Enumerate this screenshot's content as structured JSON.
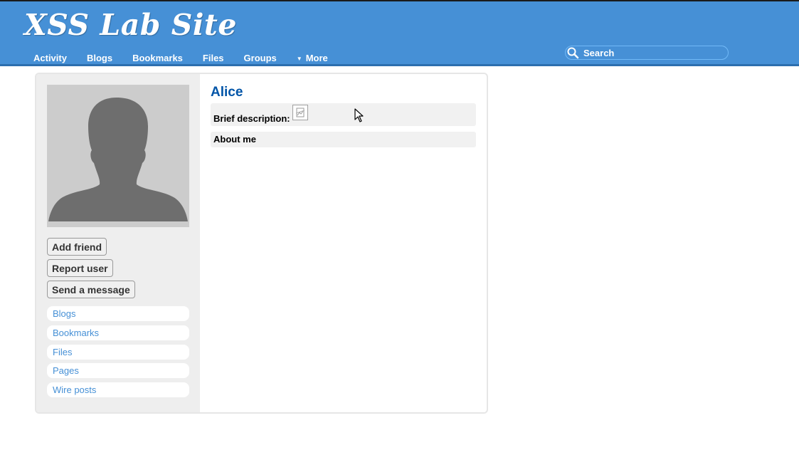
{
  "site": {
    "title": "XSS Lab Site"
  },
  "nav": {
    "items": [
      "Activity",
      "Blogs",
      "Bookmarks",
      "Files",
      "Groups"
    ],
    "more_label": "More",
    "more_arrow": "▼"
  },
  "search": {
    "placeholder": "Search",
    "icon": "search-icon"
  },
  "profile": {
    "name": "Alice",
    "avatar_icon": "default-user-silhouette-icon",
    "buttons": {
      "add_friend": "Add friend",
      "report_user": "Report user",
      "send_message": "Send a message"
    },
    "menu": [
      "Blogs",
      "Bookmarks",
      "Files",
      "Pages",
      "Wire posts"
    ],
    "fields": {
      "brief_description_label": "Brief description:",
      "brief_description_value_icon": "broken-image-icon",
      "about_me_label": "About me"
    }
  },
  "colors": {
    "header_bg": "#4690d6",
    "name_color": "#0054a7",
    "link_color": "#4690d6",
    "sidebar_bg": "#eeeeee"
  }
}
